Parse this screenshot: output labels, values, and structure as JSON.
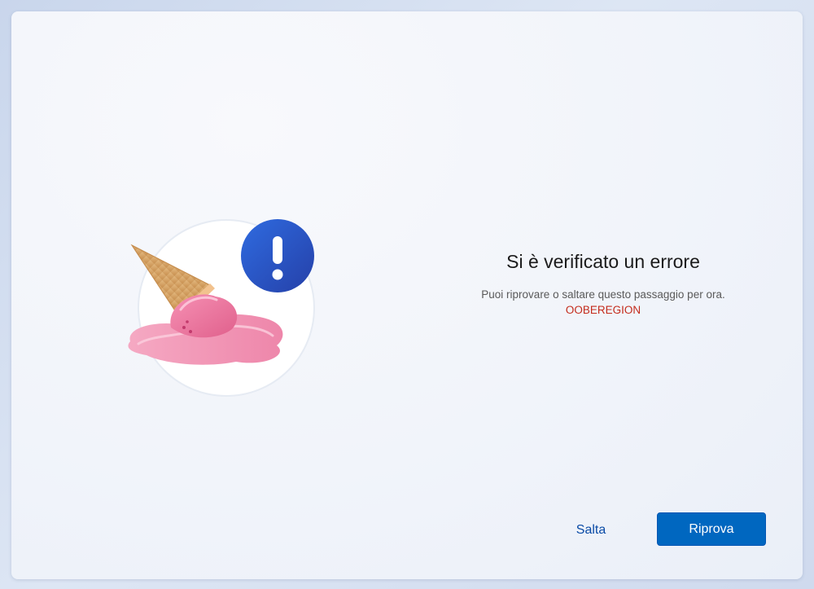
{
  "dialog": {
    "title": "Si è verificato un errore",
    "description": "Puoi riprovare o saltare questo passaggio per ora.",
    "error_code": "OOBEREGION"
  },
  "actions": {
    "skip_label": "Salta",
    "retry_label": "Riprova"
  },
  "illustration": {
    "icons": [
      "melted-ice-cream-icon",
      "exclamation-icon"
    ]
  },
  "colors": {
    "accent": "#0067c0",
    "error_text": "#c42b1c",
    "link": "#0a4ba6"
  }
}
